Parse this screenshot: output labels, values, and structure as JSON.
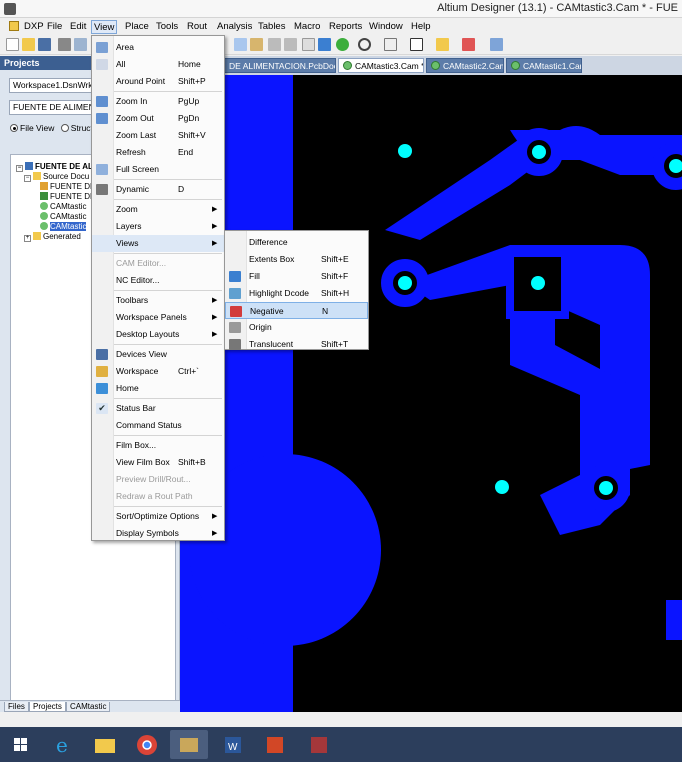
{
  "window": {
    "title": "Altium Designer (13.1) - CAMtastic3.Cam * - FUE"
  },
  "menubar": {
    "items": [
      "DXP",
      "File",
      "Edit",
      "View",
      "Place",
      "Tools",
      "Rout",
      "Analysis",
      "Tables",
      "Macro",
      "Reports",
      "Window",
      "Help"
    ]
  },
  "tabs": [
    {
      "label": "DE ALIMENTACION.PcbDoc"
    },
    {
      "label": "CAMtastic3.Cam *"
    },
    {
      "label": "CAMtastic2.Cam"
    },
    {
      "label": "CAMtastic1.Cam"
    }
  ],
  "projects_panel": {
    "header": "Projects",
    "workspace_combo": "Workspace1.DsnWrk",
    "project_combo": "FUENTE DE ALIMENTA",
    "file_view_label": "File View",
    "structure_label": "Struct",
    "tree": [
      {
        "label": "FUENTE DE ALI",
        "bold": true
      },
      {
        "label": "Source Docu"
      },
      {
        "label": "FUENTE DE"
      },
      {
        "label": "FUENTE DE"
      },
      {
        "label": "CAMtastic"
      },
      {
        "label": "CAMtastic"
      },
      {
        "label": "CAMtastic"
      },
      {
        "label": "Generated"
      }
    ],
    "bottom_tabs": [
      "Files",
      "Projects",
      "CAMtastic"
    ]
  },
  "view_menu": {
    "items": [
      {
        "label": "Area",
        "shortcut": "",
        "submenu": false,
        "disabled": false,
        "sep_before": false,
        "icon": "area-zoom-icon"
      },
      {
        "label": "All",
        "shortcut": "Home",
        "submenu": false,
        "disabled": false,
        "sep_before": false,
        "icon": "fit-all-icon"
      },
      {
        "label": "Around Point",
        "shortcut": "Shift+P",
        "submenu": false,
        "disabled": false,
        "sep_before": false,
        "icon": ""
      },
      {
        "label": "Zoom In",
        "shortcut": "PgUp",
        "submenu": false,
        "disabled": false,
        "sep_before": true,
        "icon": "zoom-in-icon"
      },
      {
        "label": "Zoom Out",
        "shortcut": "PgDn",
        "submenu": false,
        "disabled": false,
        "sep_before": false,
        "icon": "zoom-out-icon"
      },
      {
        "label": "Zoom Last",
        "shortcut": "Shift+V",
        "submenu": false,
        "disabled": false,
        "sep_before": false,
        "icon": ""
      },
      {
        "label": "Refresh",
        "shortcut": "End",
        "submenu": false,
        "disabled": false,
        "sep_before": false,
        "icon": ""
      },
      {
        "label": "Full Screen",
        "shortcut": "",
        "submenu": false,
        "disabled": false,
        "sep_before": false,
        "icon": "full-screen-icon"
      },
      {
        "label": "Dynamic",
        "shortcut": "D",
        "submenu": false,
        "disabled": false,
        "sep_before": true,
        "icon": "dynamic-icon"
      },
      {
        "label": "Zoom",
        "shortcut": "",
        "submenu": true,
        "disabled": false,
        "sep_before": true,
        "icon": ""
      },
      {
        "label": "Layers",
        "shortcut": "",
        "submenu": true,
        "disabled": false,
        "sep_before": false,
        "icon": ""
      },
      {
        "label": "Views",
        "shortcut": "",
        "submenu": true,
        "disabled": false,
        "sep_before": false,
        "icon": ""
      },
      {
        "label": "CAM Editor...",
        "shortcut": "",
        "submenu": false,
        "disabled": true,
        "sep_before": true,
        "icon": ""
      },
      {
        "label": "NC Editor...",
        "shortcut": "",
        "submenu": false,
        "disabled": false,
        "sep_before": false,
        "icon": ""
      },
      {
        "label": "Toolbars",
        "shortcut": "",
        "submenu": true,
        "disabled": false,
        "sep_before": true,
        "icon": ""
      },
      {
        "label": "Workspace Panels",
        "shortcut": "",
        "submenu": true,
        "disabled": false,
        "sep_before": false,
        "icon": ""
      },
      {
        "label": "Desktop Layouts",
        "shortcut": "",
        "submenu": true,
        "disabled": false,
        "sep_before": false,
        "icon": ""
      },
      {
        "label": "Devices View",
        "shortcut": "",
        "submenu": false,
        "disabled": false,
        "sep_before": true,
        "icon": "devices-view-icon"
      },
      {
        "label": "Workspace",
        "shortcut": "Ctrl+`",
        "submenu": false,
        "disabled": false,
        "sep_before": false,
        "icon": "workspace-icon"
      },
      {
        "label": "Home",
        "shortcut": "",
        "submenu": false,
        "disabled": false,
        "sep_before": false,
        "icon": "home-icon"
      },
      {
        "label": "Status Bar",
        "shortcut": "",
        "submenu": false,
        "disabled": false,
        "sep_before": true,
        "icon": "check-icon"
      },
      {
        "label": "Command Status",
        "shortcut": "",
        "submenu": false,
        "disabled": false,
        "sep_before": false,
        "icon": ""
      },
      {
        "label": "Film Box...",
        "shortcut": "",
        "submenu": false,
        "disabled": false,
        "sep_before": true,
        "icon": ""
      },
      {
        "label": "View Film Box",
        "shortcut": "Shift+B",
        "submenu": false,
        "disabled": false,
        "sep_before": false,
        "icon": ""
      },
      {
        "label": "Preview Drill/Rout...",
        "shortcut": "",
        "submenu": false,
        "disabled": true,
        "sep_before": false,
        "icon": ""
      },
      {
        "label": "Redraw a Rout Path",
        "shortcut": "",
        "submenu": false,
        "disabled": true,
        "sep_before": false,
        "icon": ""
      },
      {
        "label": "Sort/Optimize Options",
        "shortcut": "",
        "submenu": true,
        "disabled": false,
        "sep_before": true,
        "icon": ""
      },
      {
        "label": "Display Symbols",
        "shortcut": "",
        "submenu": true,
        "disabled": false,
        "sep_before": false,
        "icon": ""
      }
    ]
  },
  "views_submenu": {
    "items": [
      {
        "label": "Difference",
        "shortcut": "",
        "icon": ""
      },
      {
        "label": "Extents Box",
        "shortcut": "Shift+E",
        "icon": ""
      },
      {
        "label": "Fill",
        "shortcut": "Shift+F",
        "icon": "fill-icon"
      },
      {
        "label": "Highlight Dcode",
        "shortcut": "Shift+H",
        "icon": "highlight-dcode-icon"
      },
      {
        "label": "Negative",
        "shortcut": "N",
        "icon": "negative-icon"
      },
      {
        "label": "Origin",
        "shortcut": "",
        "icon": "origin-icon"
      },
      {
        "label": "Translucent",
        "shortcut": "Shift+T",
        "icon": "translucent-icon"
      }
    ]
  },
  "colors": {
    "copper": "#0a14ff",
    "pad": "#00ffff",
    "background": "#000000",
    "menu_highlight": "#cde1f7"
  }
}
